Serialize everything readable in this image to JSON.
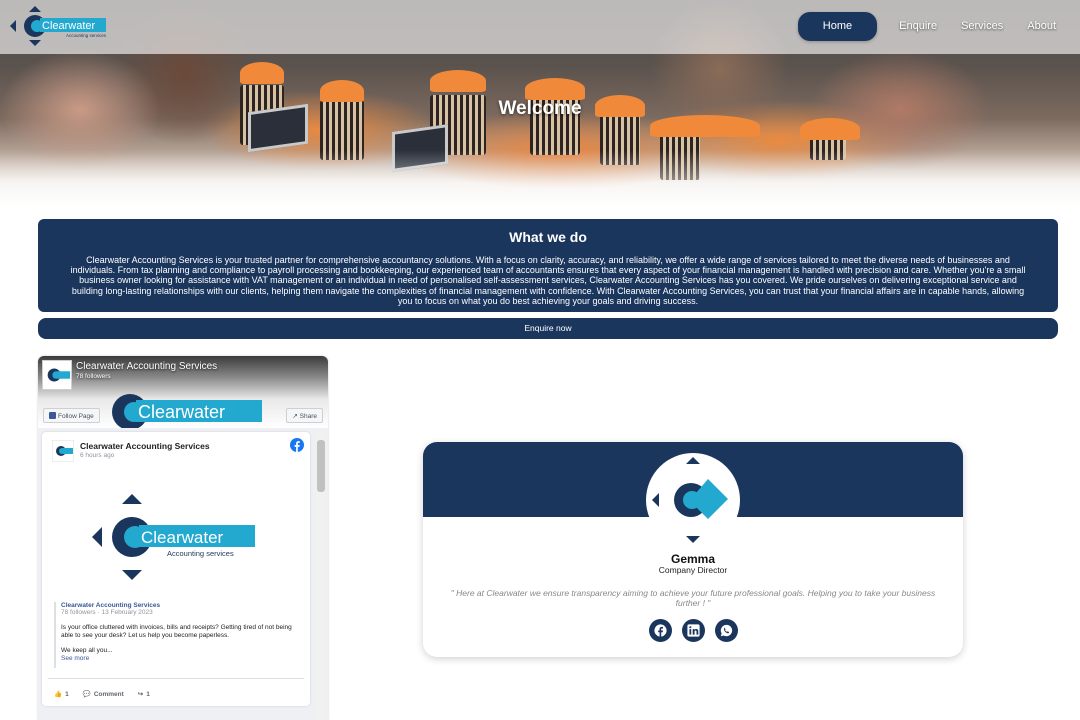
{
  "brand": {
    "logo_text": "Clearwater",
    "logo_sub": "Accounting services",
    "navy": "#1b365d",
    "teal": "#23a9d0"
  },
  "nav": {
    "items": [
      {
        "label": "Home",
        "active": true
      },
      {
        "label": "Enquire",
        "active": false
      },
      {
        "label": "Services",
        "active": false
      },
      {
        "label": "About",
        "active": false
      }
    ]
  },
  "hero": {
    "title": "Welcome"
  },
  "what_we_do": {
    "title": "What we do",
    "text": "Clearwater Accounting Services is your trusted partner for comprehensive accountancy solutions. With a focus on clarity, accuracy, and reliability, we offer a wide range of services tailored to meet the diverse needs of businesses and individuals. From tax planning and compliance to payroll processing and bookkeeping, our experienced team of accountants ensures that every aspect of your financial management is handled with precision and care. Whether you're a small business owner looking for assistance with VAT management or an individual in need of personalised self-assessment services, Clearwater Accounting Services has you covered. We pride ourselves on delivering exceptional service and building long-lasting relationships with our clients, helping them navigate the complexities of financial management with confidence. With Clearwater Accounting Services, you can trust that your financial affairs are in capable hands, allowing you to focus on what you do best achieving your goals and driving success.",
    "button": "Enquire now"
  },
  "facebook": {
    "page_name": "Clearwater Accounting Services",
    "followers": "78 followers",
    "follow_label": "Follow Page",
    "share_label": "Share",
    "post": {
      "author": "Clearwater Accounting Services",
      "time": "6 hours ago",
      "shared_name": "Clearwater Accounting Services",
      "shared_meta": "78 followers · 13 February 2023",
      "shared_text": "Is your office cluttered with invoices, bills and receipts? Getting tired of not being able to see your desk? Let us help you become paperless.",
      "shared_more": "We keep all you...",
      "see_more": "See more",
      "likes": "1",
      "comment_label": "Comment",
      "shares": "1"
    }
  },
  "profile": {
    "name": "Gemma",
    "role": "Company Director",
    "quote": "\" Here at Clearwater we ensure transparency aiming to achieve your future professional goals. Helping you to take your business further ! \"",
    "socials": [
      "facebook-icon",
      "linkedin-icon",
      "whatsapp-icon"
    ]
  }
}
